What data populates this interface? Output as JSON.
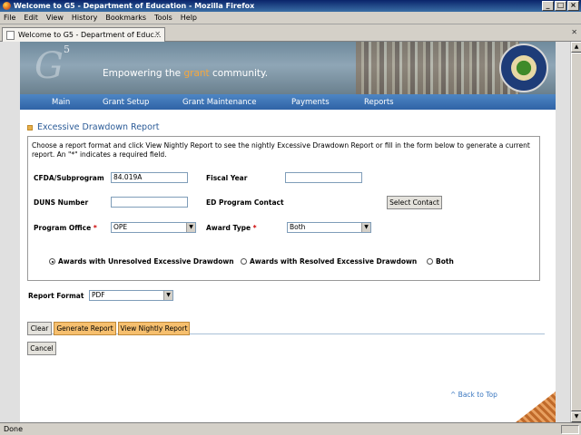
{
  "window": {
    "title": "Welcome to G5 - Department of Education - Mozilla Firefox"
  },
  "menu": [
    "File",
    "Edit",
    "View",
    "History",
    "Bookmarks",
    "Tools",
    "Help"
  ],
  "tab": {
    "label": "Welcome to G5 - Department of Educ...",
    "close": "✕"
  },
  "banner": {
    "logo": "G",
    "logo_sup": "5",
    "tagline_pre": "Empowering the ",
    "tagline_hl": "grant",
    "tagline_post": " community."
  },
  "nav": [
    "Main",
    "Grant Setup",
    "Grant Maintenance",
    "Payments",
    "Reports"
  ],
  "page_title": "Excessive Drawdown Report",
  "intro": "Choose a report format and click View Nightly Report to see the nightly Excessive Drawdown Report or fill in the form below to generate a current report. An \"*\" indicates a required field.",
  "form": {
    "cfda_label": "CFDA/Subprogram",
    "cfda_value": "84.019A",
    "fiscal_year_label": "Fiscal Year",
    "fiscal_year_value": "",
    "duns_label": "DUNS Number",
    "duns_value": "",
    "ed_contact_label": "ED Program Contact",
    "select_contact": "Select Contact",
    "program_office_label": "Program Office",
    "program_office_value": "OPE",
    "award_type_label": "Award Type",
    "award_type_value": "Both",
    "required_mark": "*"
  },
  "radios": [
    {
      "label": "Awards with Unresolved Excessive Drawdown",
      "selected": true
    },
    {
      "label": "Awards with Resolved Excessive Drawdown",
      "selected": false
    },
    {
      "label": "Both",
      "selected": false
    }
  ],
  "report_format": {
    "label": "Report Format",
    "value": "PDF"
  },
  "buttons": {
    "clear": "Clear",
    "generate": "Generate Report",
    "nightly": "View Nightly Report",
    "cancel": "Cancel"
  },
  "back_to_top": "^ Back to Top",
  "status": "Done",
  "colors": {
    "nav": "#2f63a6",
    "title": "#2b5b97",
    "accent_button": "#f6bf6e"
  }
}
